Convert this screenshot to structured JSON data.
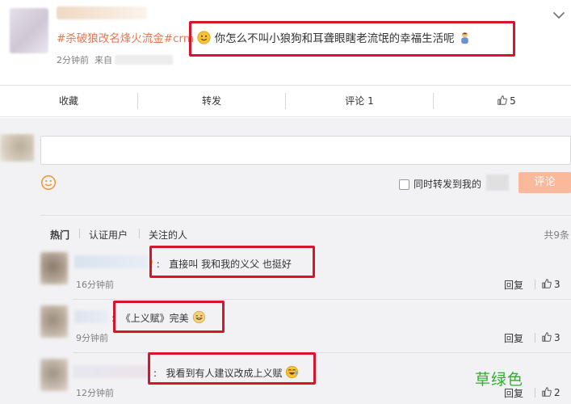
{
  "post": {
    "hashtag": "#杀破狼改名烽火流金#",
    "mention": "crm",
    "text": "你怎么不叫小狼狗和耳聋眼瞎老流氓的幸福生活呢",
    "time": "2分钟前",
    "source_prefix": "来自"
  },
  "actions": {
    "collect": "收藏",
    "repost": "转发",
    "comment": "评论 1",
    "like_count": "5"
  },
  "composer": {
    "placeholder": "",
    "repost_label": "同时转发到我的",
    "submit": "评论"
  },
  "filters": {
    "tabs": [
      "热门",
      "认证用户",
      "关注的人"
    ],
    "total": "共9条"
  },
  "comments": [
    {
      "text": "直接叫 我和我的义父 也挺好",
      "time": "16分钟前",
      "reply": "回复",
      "likes": "3"
    },
    {
      "text": "《上义赋》完美",
      "time": "9分钟前",
      "reply": "回复",
      "likes": "3"
    },
    {
      "text": "我看到有人建议改成上义赋",
      "time": "12分钟前",
      "reply": "回复",
      "likes": "2"
    }
  ],
  "watermark": "草绿色",
  "colors": {
    "hashtag": "#eb7350",
    "annotation_box": "#d8142a",
    "submit_button": "#fbb99b",
    "watermark": "#2fae2f"
  },
  "icons": [
    "chevron-down-icon",
    "smile-emoji-icon",
    "person-emoji-icon",
    "smiley-icon",
    "thumbs-up-icon",
    "grin-emoji-icon",
    "laughing-emoji-icon"
  ]
}
